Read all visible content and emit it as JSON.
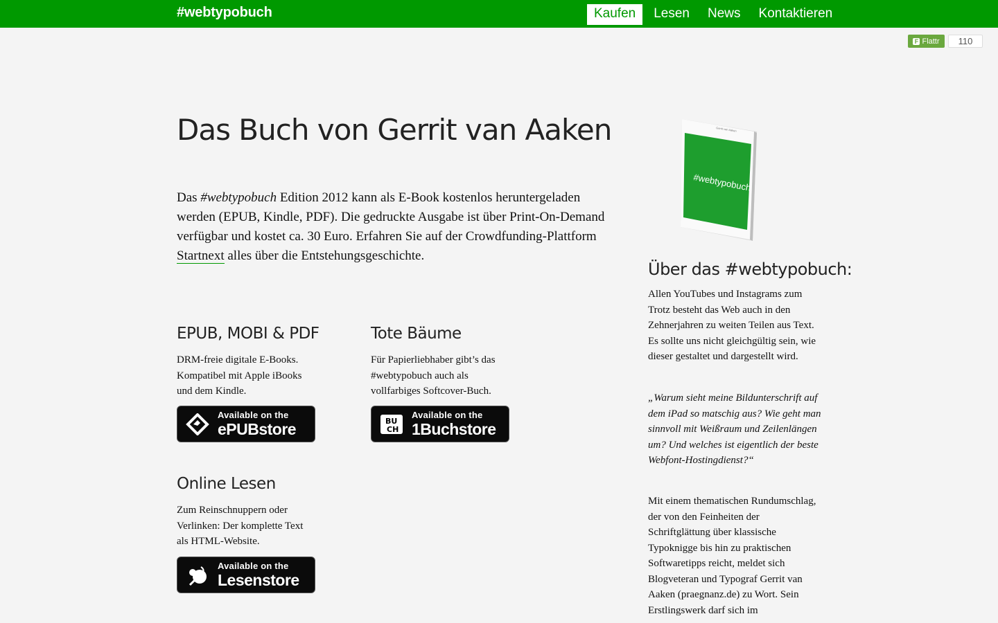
{
  "header": {
    "brand": "#webtypobuch",
    "nav": [
      "Kaufen",
      "Lesen",
      "News",
      "Kontaktieren"
    ],
    "active_nav": "Kaufen",
    "accent_color": "#009900"
  },
  "flattr": {
    "label": "Flattr",
    "count": "110"
  },
  "main": {
    "title": "Das Buch von Gerrit van Aaken",
    "intro": {
      "before_em": "Das ",
      "em": "#webtypobuch",
      "after_em": " Edition 2012 kann als E-Book kostenlos heruntergeladen werden (EPUB, Kindle, PDF). Die gedruckte Ausgabe ist über Print-On-Demand verfügbar und kostet ca. 30 Euro. Erfahren Sie auf der Crowdfunding-Plattform ",
      "link": "Startnext",
      "after_link": " alles über die Entstehungsgeschichte."
    },
    "sections": [
      {
        "heading": "EPUB, MOBI & PDF",
        "text": "DRM-freie digitale E-Books. Kompatibel mit Apple iBooks und dem Kindle.",
        "badge": {
          "top": "Available on the",
          "name": "ePUBstore",
          "icon": "epub-icon"
        }
      },
      {
        "heading": "Tote Bäume",
        "text": "Für Papierliebhaber gibt’s das #webtypobuch auch als vollfarbiges Softcover-Buch.",
        "badge": {
          "top": "Available on the",
          "name": "1Buchstore",
          "icon": "buch-icon"
        }
      },
      {
        "heading": "Online Lesen",
        "text": "Zum Reinschnuppern oder Verlinken: Der komplette Text als HTML-Website.",
        "badge": {
          "top": "Available on the",
          "name": "Lesenstore",
          "icon": "reader-icon"
        }
      }
    ]
  },
  "sidebar": {
    "book_cover": {
      "author": "Gerrit van Aaken",
      "title": "#webtypobuch"
    },
    "heading": "Über das #webtypobuch:",
    "paragraphs": [
      "Allen YouTubes und Instagrams zum Trotz besteht das Web auch in den Zehnerjahren zu weiten Teilen aus Text. Es sollte uns nicht gleichgültig sein, wie dieser gestaltet und dargestellt wird.",
      "„Warum sieht meine Bildunterschrift auf dem iPad so matschig aus? Wie geht man sinnvoll mit Weißraum und Zeilenlängen um? Und welches ist eigentlich der beste Webfont-Hostingdienst?“",
      "Mit einem thematischen Rundumschlag, der von den Feinheiten der Schriftglättung über klassische Typoknigge bis hin zu praktischen Softwaretipps reicht, meldet sich Blogveteran und Typograf Gerrit van Aaken (praegnanz.de) zu Wort. Sein Erstlingswerk darf sich im"
    ]
  }
}
